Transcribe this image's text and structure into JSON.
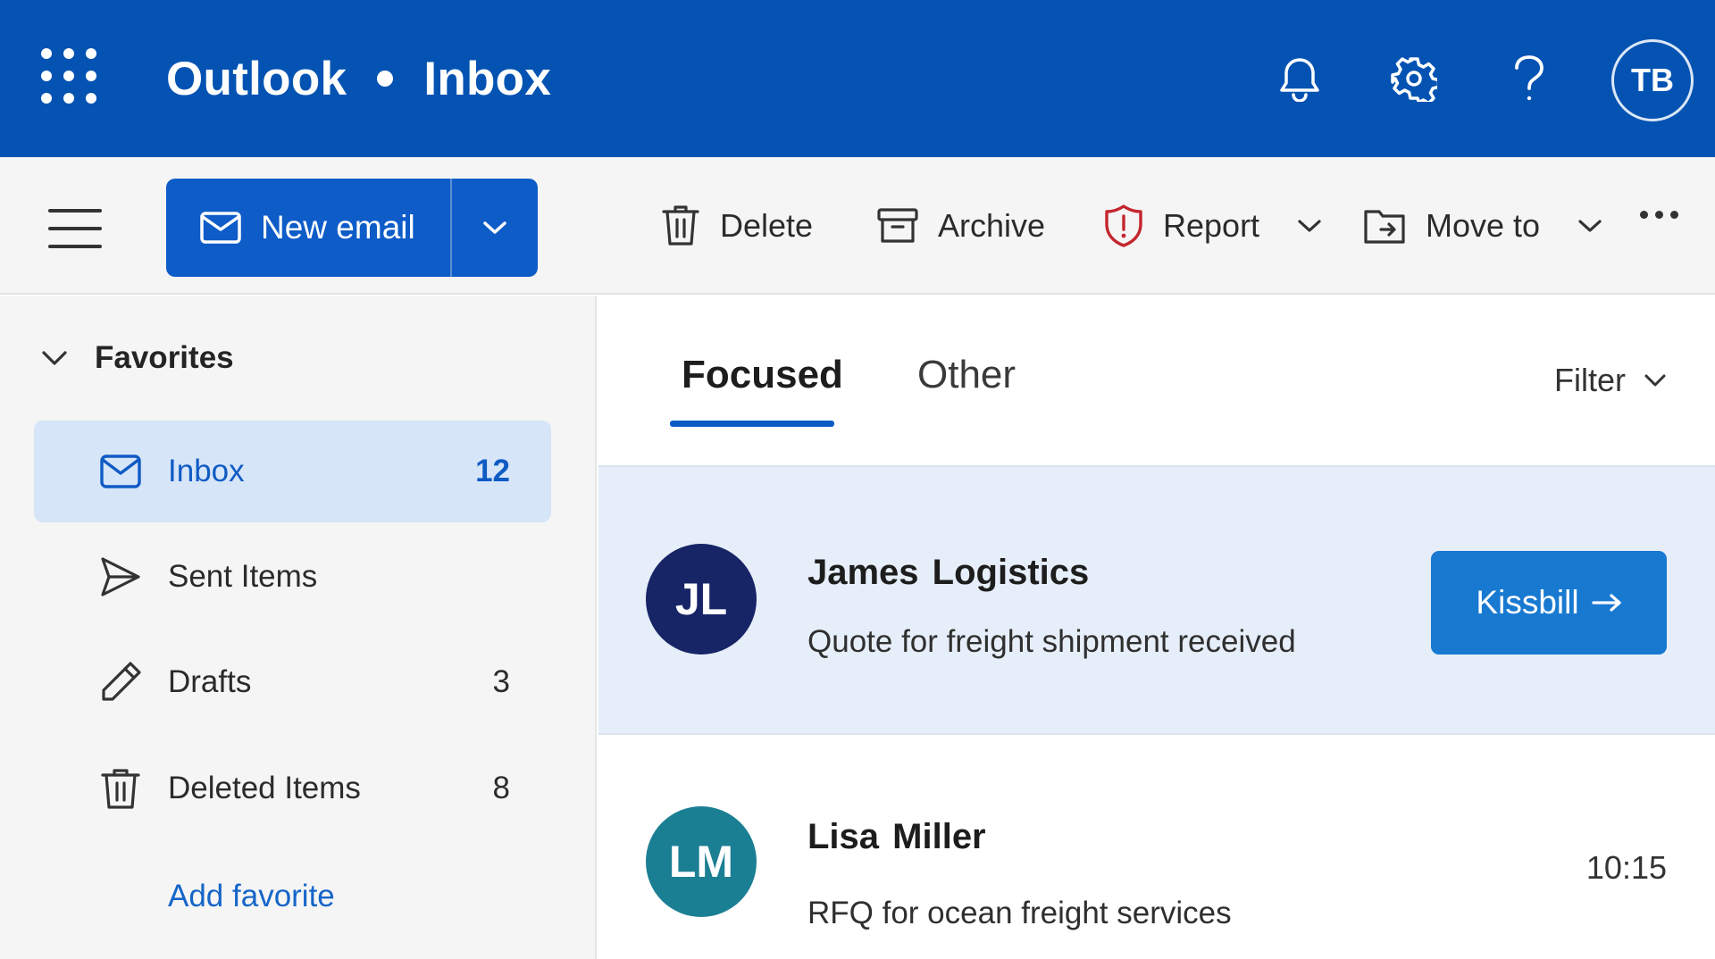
{
  "header": {
    "app_name": "Outlook",
    "folder": "Inbox",
    "avatar_initials": "TB",
    "bg_color": "#0453b3",
    "icons": [
      "waffle-icon",
      "bell-icon",
      "gear-icon",
      "help-icon"
    ]
  },
  "toolbar": {
    "new_email_label": "New email",
    "delete_label": "Delete",
    "archive_label": "Archive",
    "report_label": "Report",
    "move_to_label": "Move to",
    "accent_color": "#0d5cc8"
  },
  "sidebar": {
    "favorites_label": "Favorites",
    "items": [
      {
        "label": "Inbox",
        "count": "12",
        "icon": "mail-icon",
        "selected": true
      },
      {
        "label": "Sent Items",
        "count": "",
        "icon": "send-icon",
        "selected": false
      },
      {
        "label": "Drafts",
        "count": "3",
        "icon": "pencil-icon",
        "selected": false
      },
      {
        "label": "Deleted Items",
        "count": "8",
        "icon": "trash-icon",
        "selected": false
      }
    ],
    "add_favorite_label": "Add favorite"
  },
  "main": {
    "tabs": [
      {
        "label": "Focused",
        "active": true
      },
      {
        "label": "Other",
        "active": false
      }
    ],
    "filter_label": "Filter",
    "messages": [
      {
        "initials": "JL",
        "sender": "James Logistics",
        "subject": "Quote for freight shipment received",
        "action_label": "Kissbill",
        "avatar_color": "#172466",
        "selected": true
      },
      {
        "initials": "LM",
        "sender": "Lisa Miller",
        "subject": "RFQ for ocean freight services",
        "time": "10:15",
        "avatar_color": "#1b7f93",
        "selected": false
      }
    ]
  }
}
